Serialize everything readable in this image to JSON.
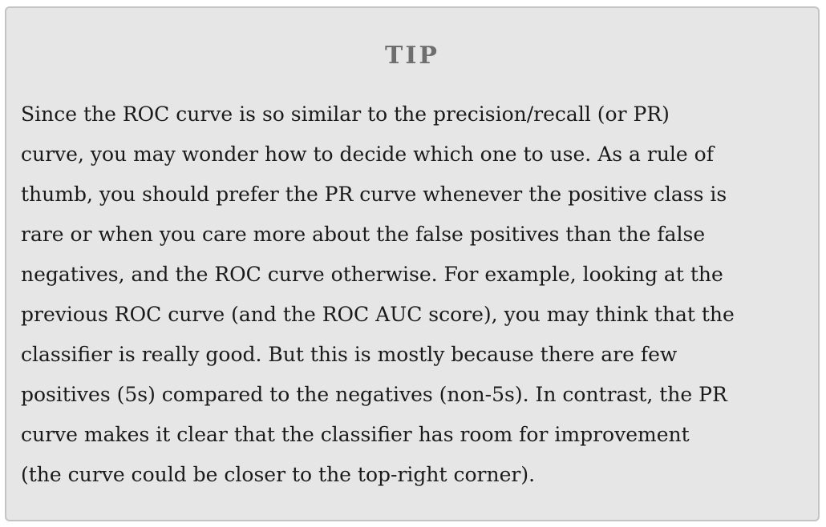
{
  "tip": {
    "title": "TIP",
    "lines": [
      "Since the ROC curve is so similar to the precision/recall (or PR)",
      "curve, you may wonder how to decide which one to use. As a rule of",
      "thumb, you should prefer the PR curve whenever the positive class is",
      "rare or when you care more about the false positives than the false",
      "negatives, and the ROC curve otherwise. For example, looking at the",
      "previous ROC curve (and the ROC AUC score), you may think that the",
      "classifier is really good. But this is mostly because there are few",
      "positives (5s) compared to the negatives (non-5s). In contrast, the PR",
      "curve makes it clear that the classifier has room for improvement",
      "(the curve could be closer to the top-right corner)."
    ]
  }
}
